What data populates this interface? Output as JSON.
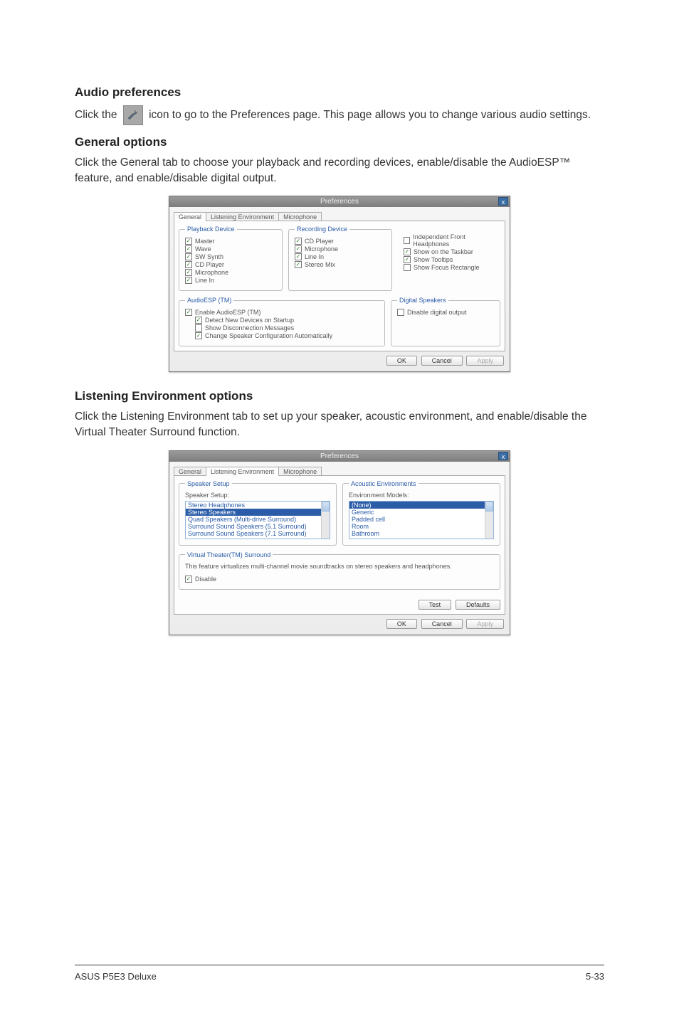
{
  "sections": {
    "audio_prefs": {
      "title": "Audio preferences",
      "text_before": "Click the ",
      "text_after": " icon to go to the Preferences page. This page allows you to change various audio settings."
    },
    "general": {
      "title": "General options",
      "body": "Click the General tab to choose your playback and recording devices, enable/disable the AudioESP™ feature, and enable/disable digital output."
    },
    "listening": {
      "title": "Listening Environment options",
      "body": "Click the Listening Environment tab to set up your speaker, acoustic environment, and enable/disable the Virtual Theater Surround function."
    }
  },
  "dialog1": {
    "title": "Preferences",
    "close": "x",
    "tabs": {
      "general": "General",
      "listening": "Listening Environment",
      "mic": "Microphone"
    },
    "groups": {
      "playback": {
        "legend": "Playback Device",
        "items": [
          "Master",
          "Wave",
          "SW Synth",
          "CD Player",
          "Microphone",
          "Line In"
        ]
      },
      "recording": {
        "legend": "Recording Device",
        "items": [
          "CD Player",
          "Microphone",
          "Line In",
          "Stereo Mix"
        ]
      },
      "settings": {
        "items": [
          {
            "label": "Independent Front Headphones",
            "checked": false
          },
          {
            "label": "Show on the Taskbar",
            "checked": true
          },
          {
            "label": "Show Tooltips",
            "checked": true
          },
          {
            "label": "Show Focus Rectangle",
            "checked": false
          }
        ]
      },
      "audioesp": {
        "legend": "AudioESP (TM)",
        "enable": "Enable AudioESP (TM)",
        "items": [
          {
            "label": "Detect New Devices on Startup",
            "checked": true
          },
          {
            "label": "Show Disconnection Messages",
            "checked": false
          },
          {
            "label": "Change Speaker Configuration Automatically",
            "checked": true
          }
        ]
      },
      "digital": {
        "legend": "Digital Speakers",
        "item": "Disable digital output"
      }
    },
    "buttons": {
      "ok": "OK",
      "cancel": "Cancel",
      "apply": "Apply"
    }
  },
  "dialog2": {
    "title": "Preferences",
    "close": "x",
    "tabs": {
      "general": "General",
      "listening": "Listening Environment",
      "mic": "Microphone"
    },
    "speakerSetup": {
      "legend": "Speaker Setup",
      "label": "Speaker Setup:",
      "options": [
        "Stereo Headphones",
        "Stereo Speakers",
        "Quad Speakers (Multi-drive Surround)",
        "Surround Sound Speakers (5.1 Surround)",
        "Surround Sound Speakers (7.1 Surround)"
      ],
      "selectedIndex": 1
    },
    "acoustic": {
      "legend": "Acoustic Environments",
      "label": "Environment Models:",
      "options": [
        "(None)",
        "Generic",
        "Padded cell",
        "Room",
        "Bathroom"
      ],
      "selectedIndex": 0
    },
    "vts": {
      "legend": "Virtual Theater(TM) Surround",
      "desc": "This feature virtualizes multi-channel movie soundtracks on stereo speakers and headphones.",
      "disable": "Disable"
    },
    "buttons": {
      "test": "Test",
      "defaults": "Defaults",
      "ok": "OK",
      "cancel": "Cancel",
      "apply": "Apply"
    }
  },
  "footer": {
    "left": "ASUS P5E3 Deluxe",
    "right": "5-33"
  }
}
